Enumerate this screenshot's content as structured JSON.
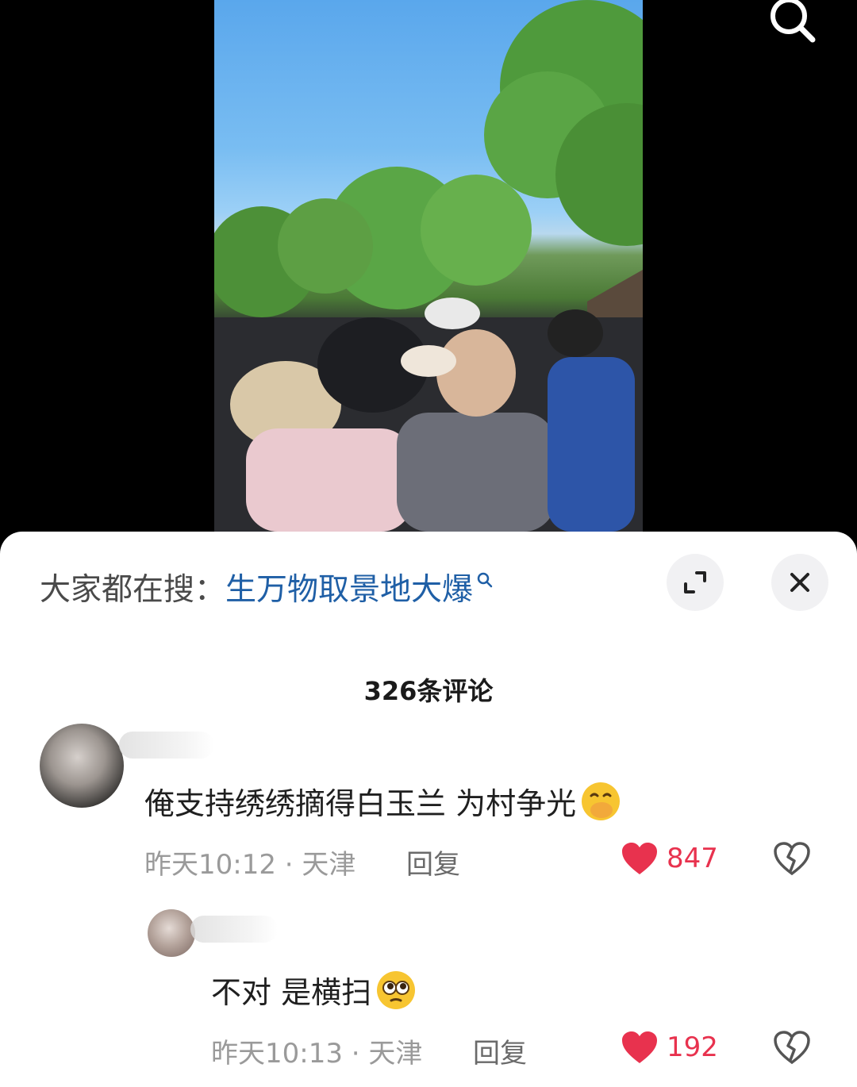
{
  "video": {
    "search_icon": "search-icon"
  },
  "suggestion": {
    "label": "大家都在搜：",
    "query": "生万物取景地大爆"
  },
  "comments_count": "326条评论",
  "comments": [
    {
      "text": "俺支持绣绣摘得白玉兰 为村争光",
      "emoji": "hand-over-mouth-emoji",
      "time_location": "昨天10:12 · 天津",
      "reply": "回复",
      "likes": "847"
    },
    {
      "text": "不对 是横扫",
      "emoji": "pleading-face-emoji",
      "time_location": "昨天10:13 · 天津",
      "reply": "回复",
      "likes": "192"
    }
  ],
  "colors": {
    "link": "#1f5fa6",
    "like": "#e8324e"
  }
}
